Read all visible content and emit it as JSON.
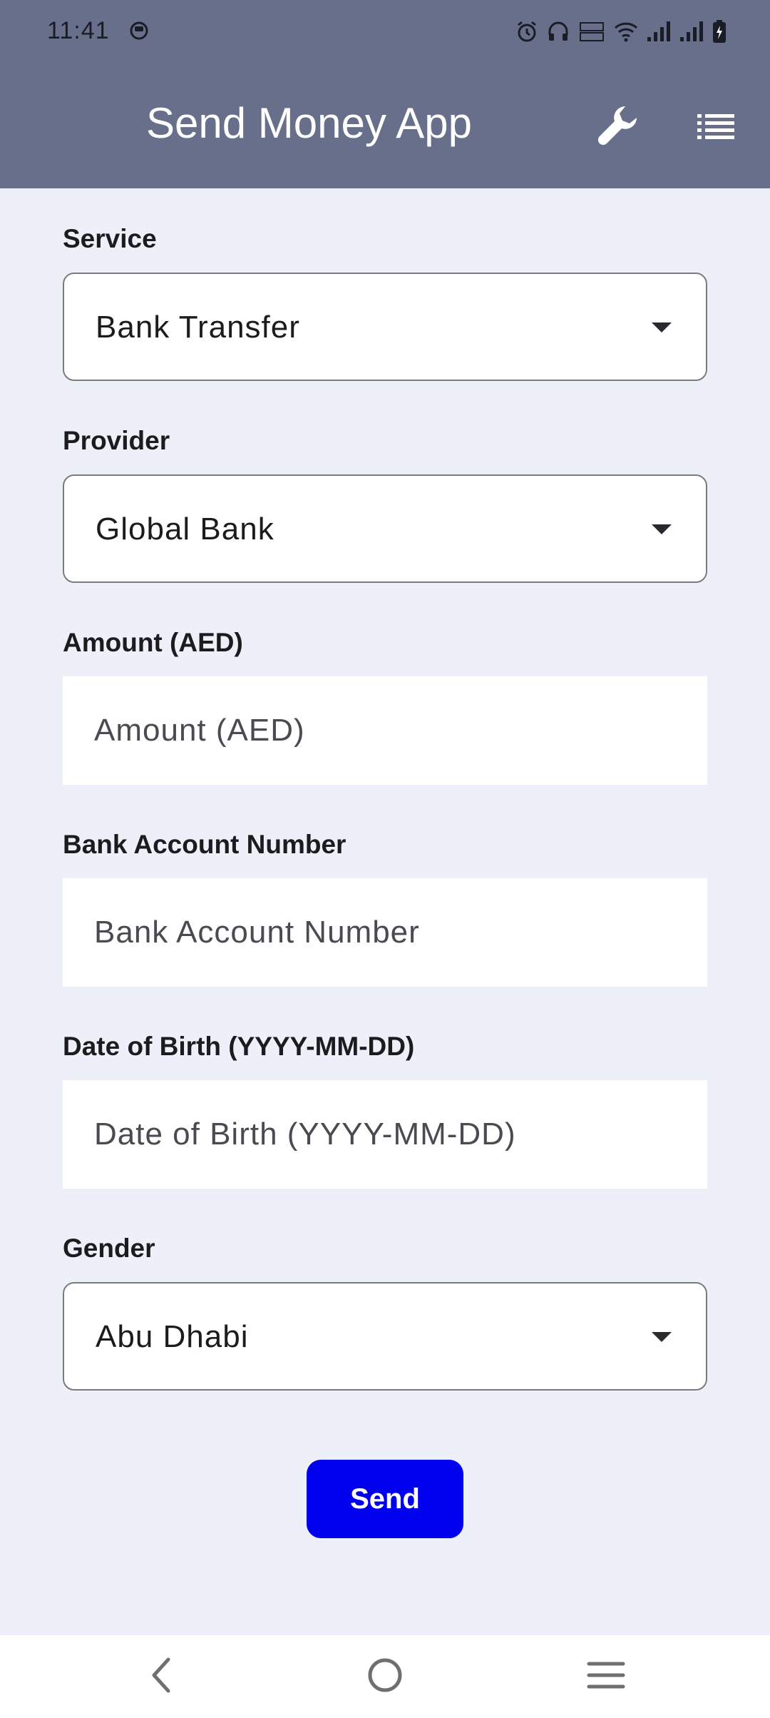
{
  "status_bar": {
    "time": "11:41",
    "icons": [
      "app-notification-icon",
      "alarm-icon",
      "headphones-icon",
      "volte-icon",
      "wifi-icon",
      "signal-icon",
      "signal-icon",
      "battery-charging-icon"
    ]
  },
  "app_bar": {
    "title": "Send Money App",
    "actions": [
      "wrench-icon",
      "list-icon"
    ]
  },
  "form": {
    "service": {
      "label": "Service",
      "value": "Bank Transfer"
    },
    "provider": {
      "label": "Provider",
      "value": "Global Bank"
    },
    "amount": {
      "label": "Amount (AED)",
      "placeholder": "Amount (AED)",
      "value": ""
    },
    "account": {
      "label": "Bank Account Number",
      "placeholder": "Bank Account Number",
      "value": ""
    },
    "dob": {
      "label": "Date of Birth (YYYY-MM-DD)",
      "placeholder": "Date of Birth (YYYY-MM-DD)",
      "value": ""
    },
    "gender": {
      "label": "Gender",
      "value": "Abu Dhabi"
    },
    "send_label": "Send"
  },
  "nav_bar": {
    "buttons": [
      "back-icon",
      "home-icon",
      "menu-icon"
    ]
  },
  "colors": {
    "header": "#676f8b",
    "background": "#eef0f9",
    "send_button": "#0000ee"
  }
}
